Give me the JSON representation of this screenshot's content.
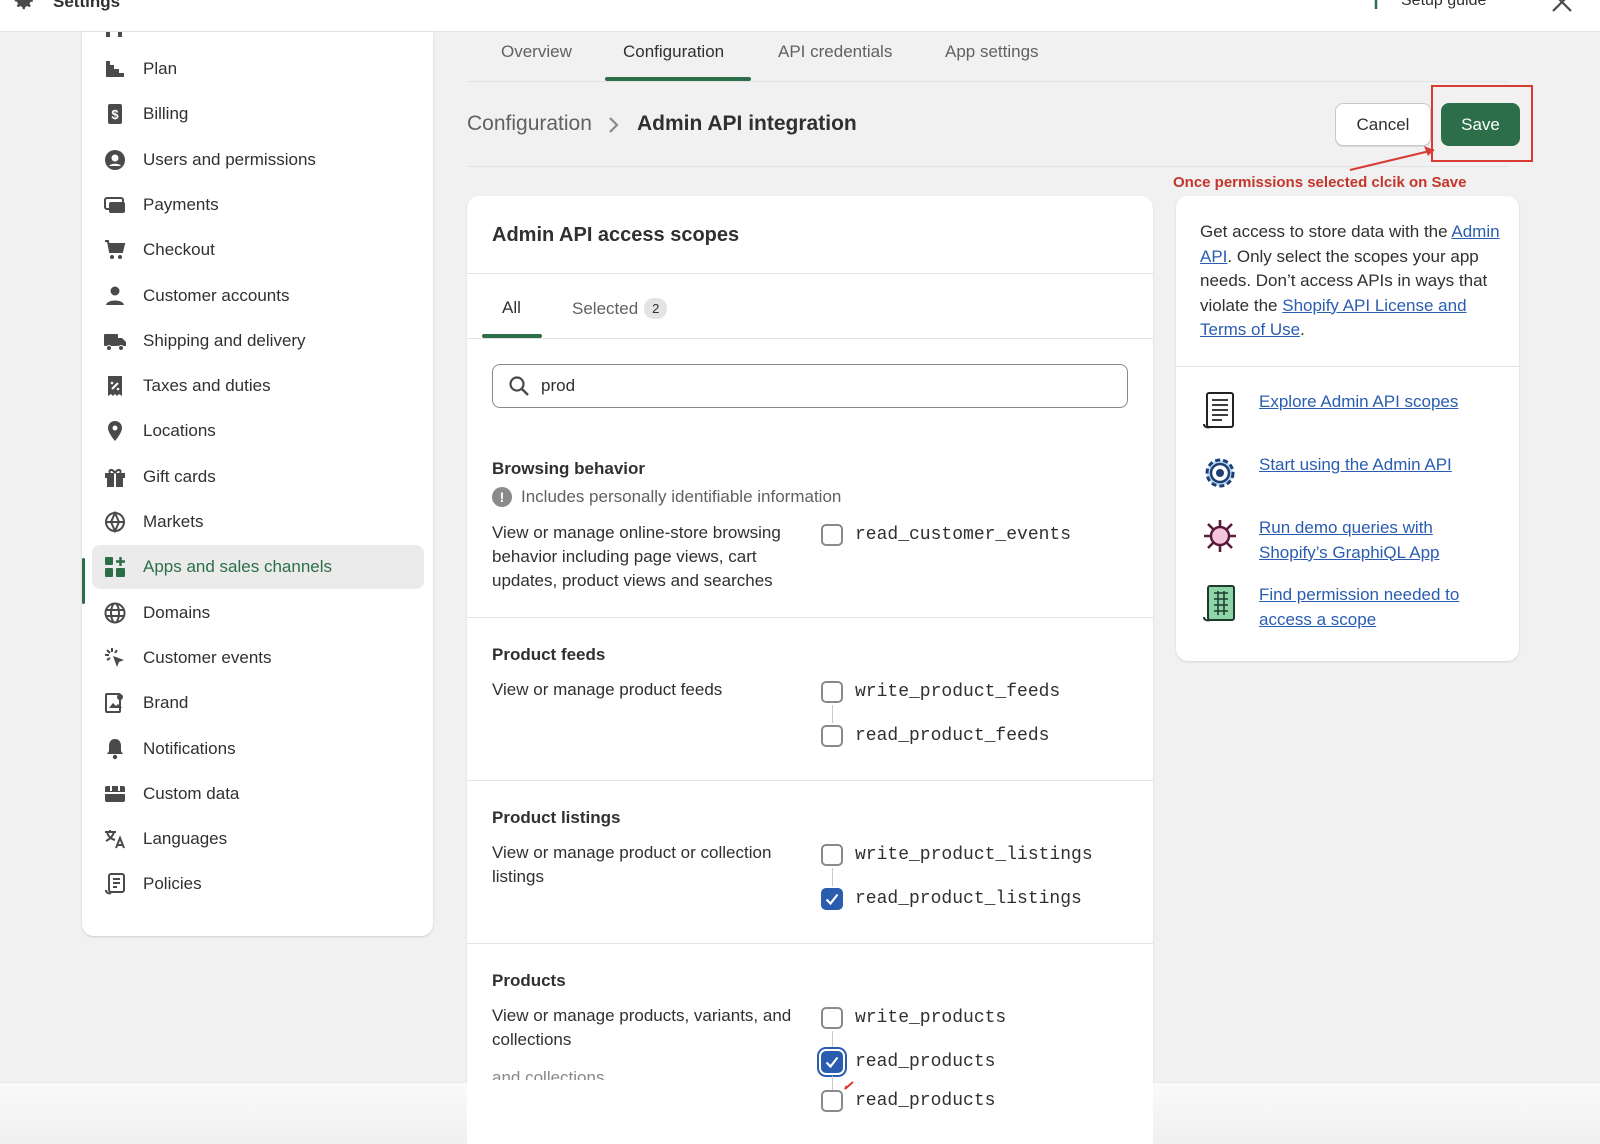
{
  "topbar": {
    "title": "Settings",
    "setup_guide": "Setup guide"
  },
  "sidebar": {
    "items": [
      {
        "label": "Plan",
        "icon": "plan-icon"
      },
      {
        "label": "Billing",
        "icon": "billing-icon"
      },
      {
        "label": "Users and permissions",
        "icon": "user-circle-icon"
      },
      {
        "label": "Payments",
        "icon": "payments-icon"
      },
      {
        "label": "Checkout",
        "icon": "cart-icon"
      },
      {
        "label": "Customer accounts",
        "icon": "person-icon"
      },
      {
        "label": "Shipping and delivery",
        "icon": "truck-icon"
      },
      {
        "label": "Taxes and duties",
        "icon": "receipt-percent-icon"
      },
      {
        "label": "Locations",
        "icon": "location-pin-icon"
      },
      {
        "label": "Gift cards",
        "icon": "gift-icon"
      },
      {
        "label": "Markets",
        "icon": "globe-markets-icon"
      },
      {
        "label": "Apps and sales channels",
        "icon": "apps-icon",
        "active": true
      },
      {
        "label": "Domains",
        "icon": "globe-icon"
      },
      {
        "label": "Customer events",
        "icon": "cursor-click-icon"
      },
      {
        "label": "Brand",
        "icon": "brand-icon"
      },
      {
        "label": "Notifications",
        "icon": "bell-icon"
      },
      {
        "label": "Custom data",
        "icon": "database-icon"
      },
      {
        "label": "Languages",
        "icon": "translate-icon"
      },
      {
        "label": "Policies",
        "icon": "policy-icon"
      }
    ]
  },
  "tabs": [
    "Overview",
    "Configuration",
    "API credentials",
    "App settings"
  ],
  "breadcrumb": {
    "parent": "Configuration",
    "current": "Admin API integration"
  },
  "actions": {
    "cancel": "Cancel",
    "save": "Save"
  },
  "annotation": "Once permissions selected clcik on Save",
  "scopes_card": {
    "title": "Admin API access scopes",
    "tab_all": "All",
    "tab_selected": "Selected",
    "selected_count": "2",
    "search_value": "prod",
    "sections": [
      {
        "title": "Browsing behavior",
        "pii": "Includes personally identifiable information",
        "desc": "View or manage online-store browsing behavior including page views, cart updates, product views and searches",
        "scopes": [
          {
            "name": "read_customer_events",
            "checked": false
          }
        ]
      },
      {
        "title": "Product feeds",
        "desc": "View or manage product feeds",
        "scopes": [
          {
            "name": "write_product_feeds",
            "checked": false
          },
          {
            "name": "read_product_feeds",
            "checked": false
          }
        ]
      },
      {
        "title": "Product listings",
        "desc": "View or manage product or collection listings",
        "scopes": [
          {
            "name": "write_product_listings",
            "checked": false
          },
          {
            "name": "read_product_listings",
            "checked": true
          }
        ]
      },
      {
        "title": "Products",
        "desc": "View or manage products, variants, and collections",
        "scopes": [
          {
            "name": "write_products",
            "checked": false
          },
          {
            "name": "read_products",
            "checked": true
          }
        ]
      }
    ],
    "ghost_desc": "and collections",
    "ghost_scope": "read_products"
  },
  "info_card": {
    "intro_1": "Get access to store data with the ",
    "intro_link_1": "Admin API",
    "intro_2": ". Only select the scopes your app needs. Don’t access APIs in ways that violate the ",
    "intro_link_2": "Shopify API License and Terms of Use",
    "intro_3": ".",
    "resources": [
      {
        "label": "Explore Admin API scopes",
        "icon": "scroll-document-icon"
      },
      {
        "label": "Start using the Admin API",
        "icon": "gear-cog-icon"
      },
      {
        "label": "Run demo queries with Shopify’s GraphiQL App",
        "icon": "graphql-bug-icon"
      },
      {
        "label": "Find permission needed to access a scope",
        "icon": "grid-scroll-icon"
      }
    ]
  },
  "colors": {
    "accent": "#2c6e49",
    "link": "#2a5db0",
    "annotation": "#c4352c"
  }
}
